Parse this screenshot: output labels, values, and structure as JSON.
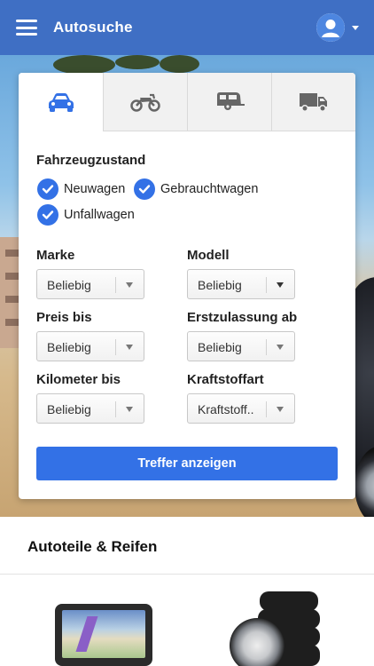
{
  "header": {
    "title": "Autosuche"
  },
  "tabs": [
    {
      "icon": "car-icon",
      "active": true
    },
    {
      "icon": "motorcycle-icon",
      "active": false
    },
    {
      "icon": "caravan-icon",
      "active": false
    },
    {
      "icon": "truck-icon",
      "active": false
    }
  ],
  "condition": {
    "label": "Fahrzeugzustand",
    "options": [
      {
        "label": "Neuwagen",
        "checked": true
      },
      {
        "label": "Gebrauchtwagen",
        "checked": true
      },
      {
        "label": "Unfallwagen",
        "checked": true
      }
    ]
  },
  "filters": {
    "marke": {
      "label": "Marke",
      "value": "Beliebig"
    },
    "modell": {
      "label": "Modell",
      "value": "Beliebig"
    },
    "preis": {
      "label": "Preis bis",
      "value": "Beliebig"
    },
    "erstzulassung": {
      "label": "Erstzulassung ab",
      "value": "Beliebig"
    },
    "kilometer": {
      "label": "Kilometer bis",
      "value": "Beliebig"
    },
    "kraftstoff": {
      "label": "Kraftstoffart",
      "value": "Kraftstoff.."
    }
  },
  "submit_label": "Treffer anzeigen",
  "bottom": {
    "title": "Autoteile & Reifen"
  },
  "colors": {
    "header": "#3f6fc4",
    "accent": "#3371e6"
  }
}
